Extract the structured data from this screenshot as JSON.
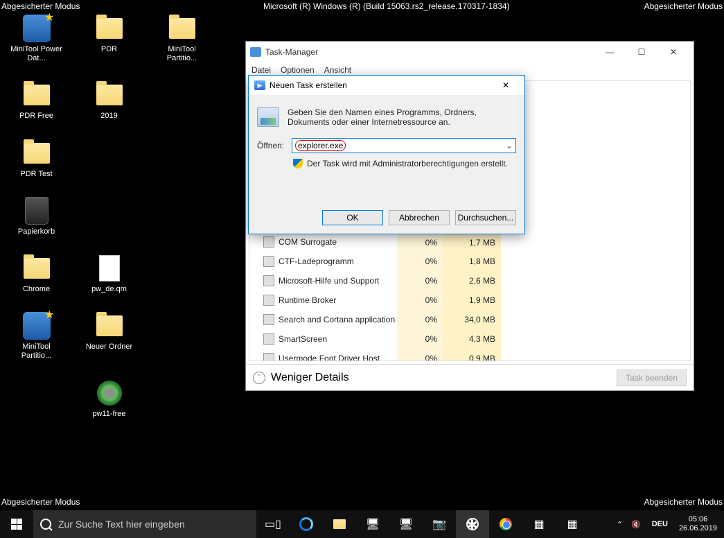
{
  "safemode_label": "Abgesicherter Modus",
  "build_label": "Microsoft (R) Windows (R) (Build 15063.rs2_release.170317-1834)",
  "desktop": [
    [
      {
        "label": "MiniTool Power Dat...",
        "type": "app-star"
      },
      {
        "label": "PDR",
        "type": "folder"
      },
      {
        "label": "MiniTool Partitio...",
        "type": "folder"
      }
    ],
    [
      {
        "label": "PDR Free",
        "type": "folder"
      },
      {
        "label": "2019",
        "type": "folder-pic"
      }
    ],
    [
      {
        "label": "PDR Test",
        "type": "folder"
      }
    ],
    [
      {
        "label": "Papierkorb",
        "type": "recycle"
      }
    ],
    [
      {
        "label": "Chrome",
        "type": "folder"
      },
      {
        "label": "pw_de.qm",
        "type": "file"
      }
    ],
    [
      {
        "label": "MiniTool Partitio...",
        "type": "app-star"
      },
      {
        "label": "Neuer Ordner",
        "type": "folder"
      }
    ],
    [
      {
        "label": "",
        "type": "spacer"
      },
      {
        "label": "pw11-free",
        "type": "disk"
      }
    ]
  ],
  "tm": {
    "title": "Task-Manager",
    "menu": [
      "Datei",
      "Optionen",
      "Ansicht"
    ],
    "rows": [
      {
        "name": "COM Surrogate",
        "cpu": "0%",
        "mem": "1,7 MB"
      },
      {
        "name": "CTF-Ladeprogramm",
        "cpu": "0%",
        "mem": "1,8 MB"
      },
      {
        "name": "Microsoft-Hilfe und Support",
        "cpu": "0%",
        "mem": "2,6 MB"
      },
      {
        "name": "Runtime Broker",
        "cpu": "0%",
        "mem": "1,9 MB"
      },
      {
        "name": "Search and Cortana application",
        "cpu": "0%",
        "mem": "34,0 MB"
      },
      {
        "name": "SmartScreen",
        "cpu": "0%",
        "mem": "4,3 MB"
      },
      {
        "name": "Usermode Font Driver Host",
        "cpu": "0%",
        "mem": "0,9 MB"
      }
    ],
    "footer_less": "Weniger Details",
    "footer_end": "Task beenden"
  },
  "run": {
    "title": "Neuen Task erstellen",
    "desc": "Geben Sie den Namen eines Programms, Ordners, Dokuments oder einer Internetressource an.",
    "open_label": "Öffnen:",
    "value": "explorer.exe",
    "admin_text": "Der Task wird mit Administratorberechtigungen erstellt.",
    "ok": "OK",
    "cancel": "Abbrechen",
    "browse": "Durchsuchen..."
  },
  "taskbar": {
    "search_placeholder": "Zur Suche Text hier eingeben",
    "lang": "DEU",
    "time": "05:06",
    "date": "26.06.2019"
  }
}
